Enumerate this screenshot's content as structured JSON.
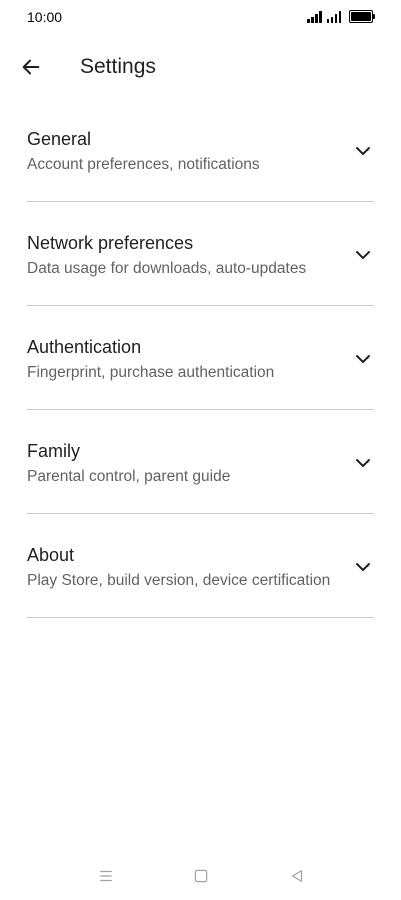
{
  "status_bar": {
    "time": "10:00",
    "icons": [
      "signal-icon",
      "signal-icon",
      "battery-icon"
    ]
  },
  "app_bar": {
    "back_icon": "arrow-left-icon",
    "title": "Settings"
  },
  "settings": {
    "items": [
      {
        "title": "General",
        "subtitle": "Account preferences, notifications",
        "icon": "chevron-down-icon"
      },
      {
        "title": "Network preferences",
        "subtitle": "Data usage for downloads, auto-updates",
        "icon": "chevron-down-icon"
      },
      {
        "title": "Authentication",
        "subtitle": "Fingerprint, purchase authentication",
        "icon": "chevron-down-icon"
      },
      {
        "title": "Family",
        "subtitle": "Parental control, parent guide",
        "icon": "chevron-down-icon"
      },
      {
        "title": "About",
        "subtitle": "Play Store, build version, device certification",
        "icon": "chevron-down-icon"
      }
    ]
  },
  "nav_bar": {
    "icons": [
      "menu-icon",
      "home-square-icon",
      "back-triangle-icon"
    ]
  },
  "colors": {
    "text_primary": "#202124",
    "text_secondary": "#5f6368",
    "divider": "#c7c7c7",
    "nav_icon": "#9aa0a6"
  }
}
